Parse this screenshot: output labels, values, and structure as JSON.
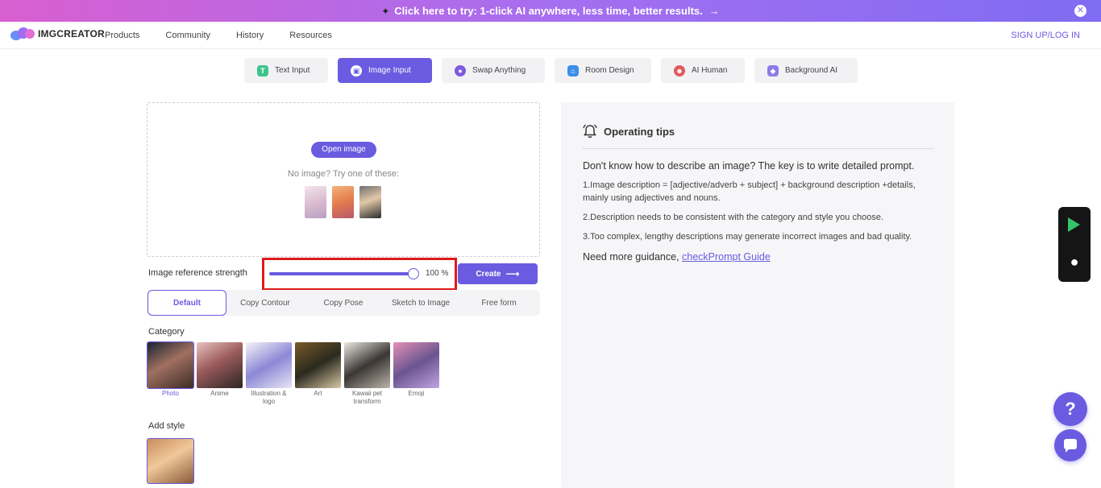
{
  "promo": {
    "text": "Click here to try: 1-click AI anywhere, less time, better results.",
    "arrow": "→",
    "close": "✕"
  },
  "nav": {
    "logo": "IMGCREATOR",
    "menu": [
      "Products",
      "Community",
      "History",
      "Resources"
    ],
    "signup": "SIGN UP/LOG IN"
  },
  "tabs": [
    {
      "label": "Text Input",
      "icon": "T",
      "color": "#3cc38a"
    },
    {
      "label": "Image Input",
      "icon": "▣",
      "color": "#6a5be0"
    },
    {
      "label": "Swap Anything",
      "icon": "●",
      "color": "#7e5ae0"
    },
    {
      "label": "Room Design",
      "icon": "⌂",
      "color": "#3a8ee8"
    },
    {
      "label": "AI Human",
      "icon": "☻",
      "color": "#e05a5a"
    },
    {
      "label": "Background AI",
      "icon": "◆",
      "color": "#8e7ae8"
    }
  ],
  "upload": {
    "open_label": "Open image",
    "hint": "No image? Try one of these:"
  },
  "strength": {
    "label": "Image reference strength",
    "value": 100,
    "value_label": "100 %"
  },
  "create_label": "Create",
  "create_arrow": "⟶",
  "modes": [
    "Default",
    "Copy Contour",
    "Copy Pose",
    "Sketch to Image",
    "Free form"
  ],
  "category": {
    "label": "Category",
    "items": [
      "Photo",
      "Anime",
      "Illustration & logo",
      "Art",
      "Kawaii pet transform",
      "Emoji"
    ]
  },
  "style": {
    "label": "Add style"
  },
  "tips": {
    "title": "Operating tips",
    "lead": "Don't know how to describe an image? The key is to write detailed prompt.",
    "items": [
      "1.Image description = [adjective/adverb + subject] + background description +details, mainly using adjectives and nouns.",
      "2.Description needs to be consistent with the category and style you choose.",
      "3.Too complex, lengthy descriptions may generate incorrect images and bad quality."
    ],
    "more_prefix": "Need more guidance, ",
    "more_link": "checkPrompt Guide"
  },
  "help": "?",
  "colors": {
    "accent": "#6a5be0",
    "highlight": "#e01a1a"
  }
}
